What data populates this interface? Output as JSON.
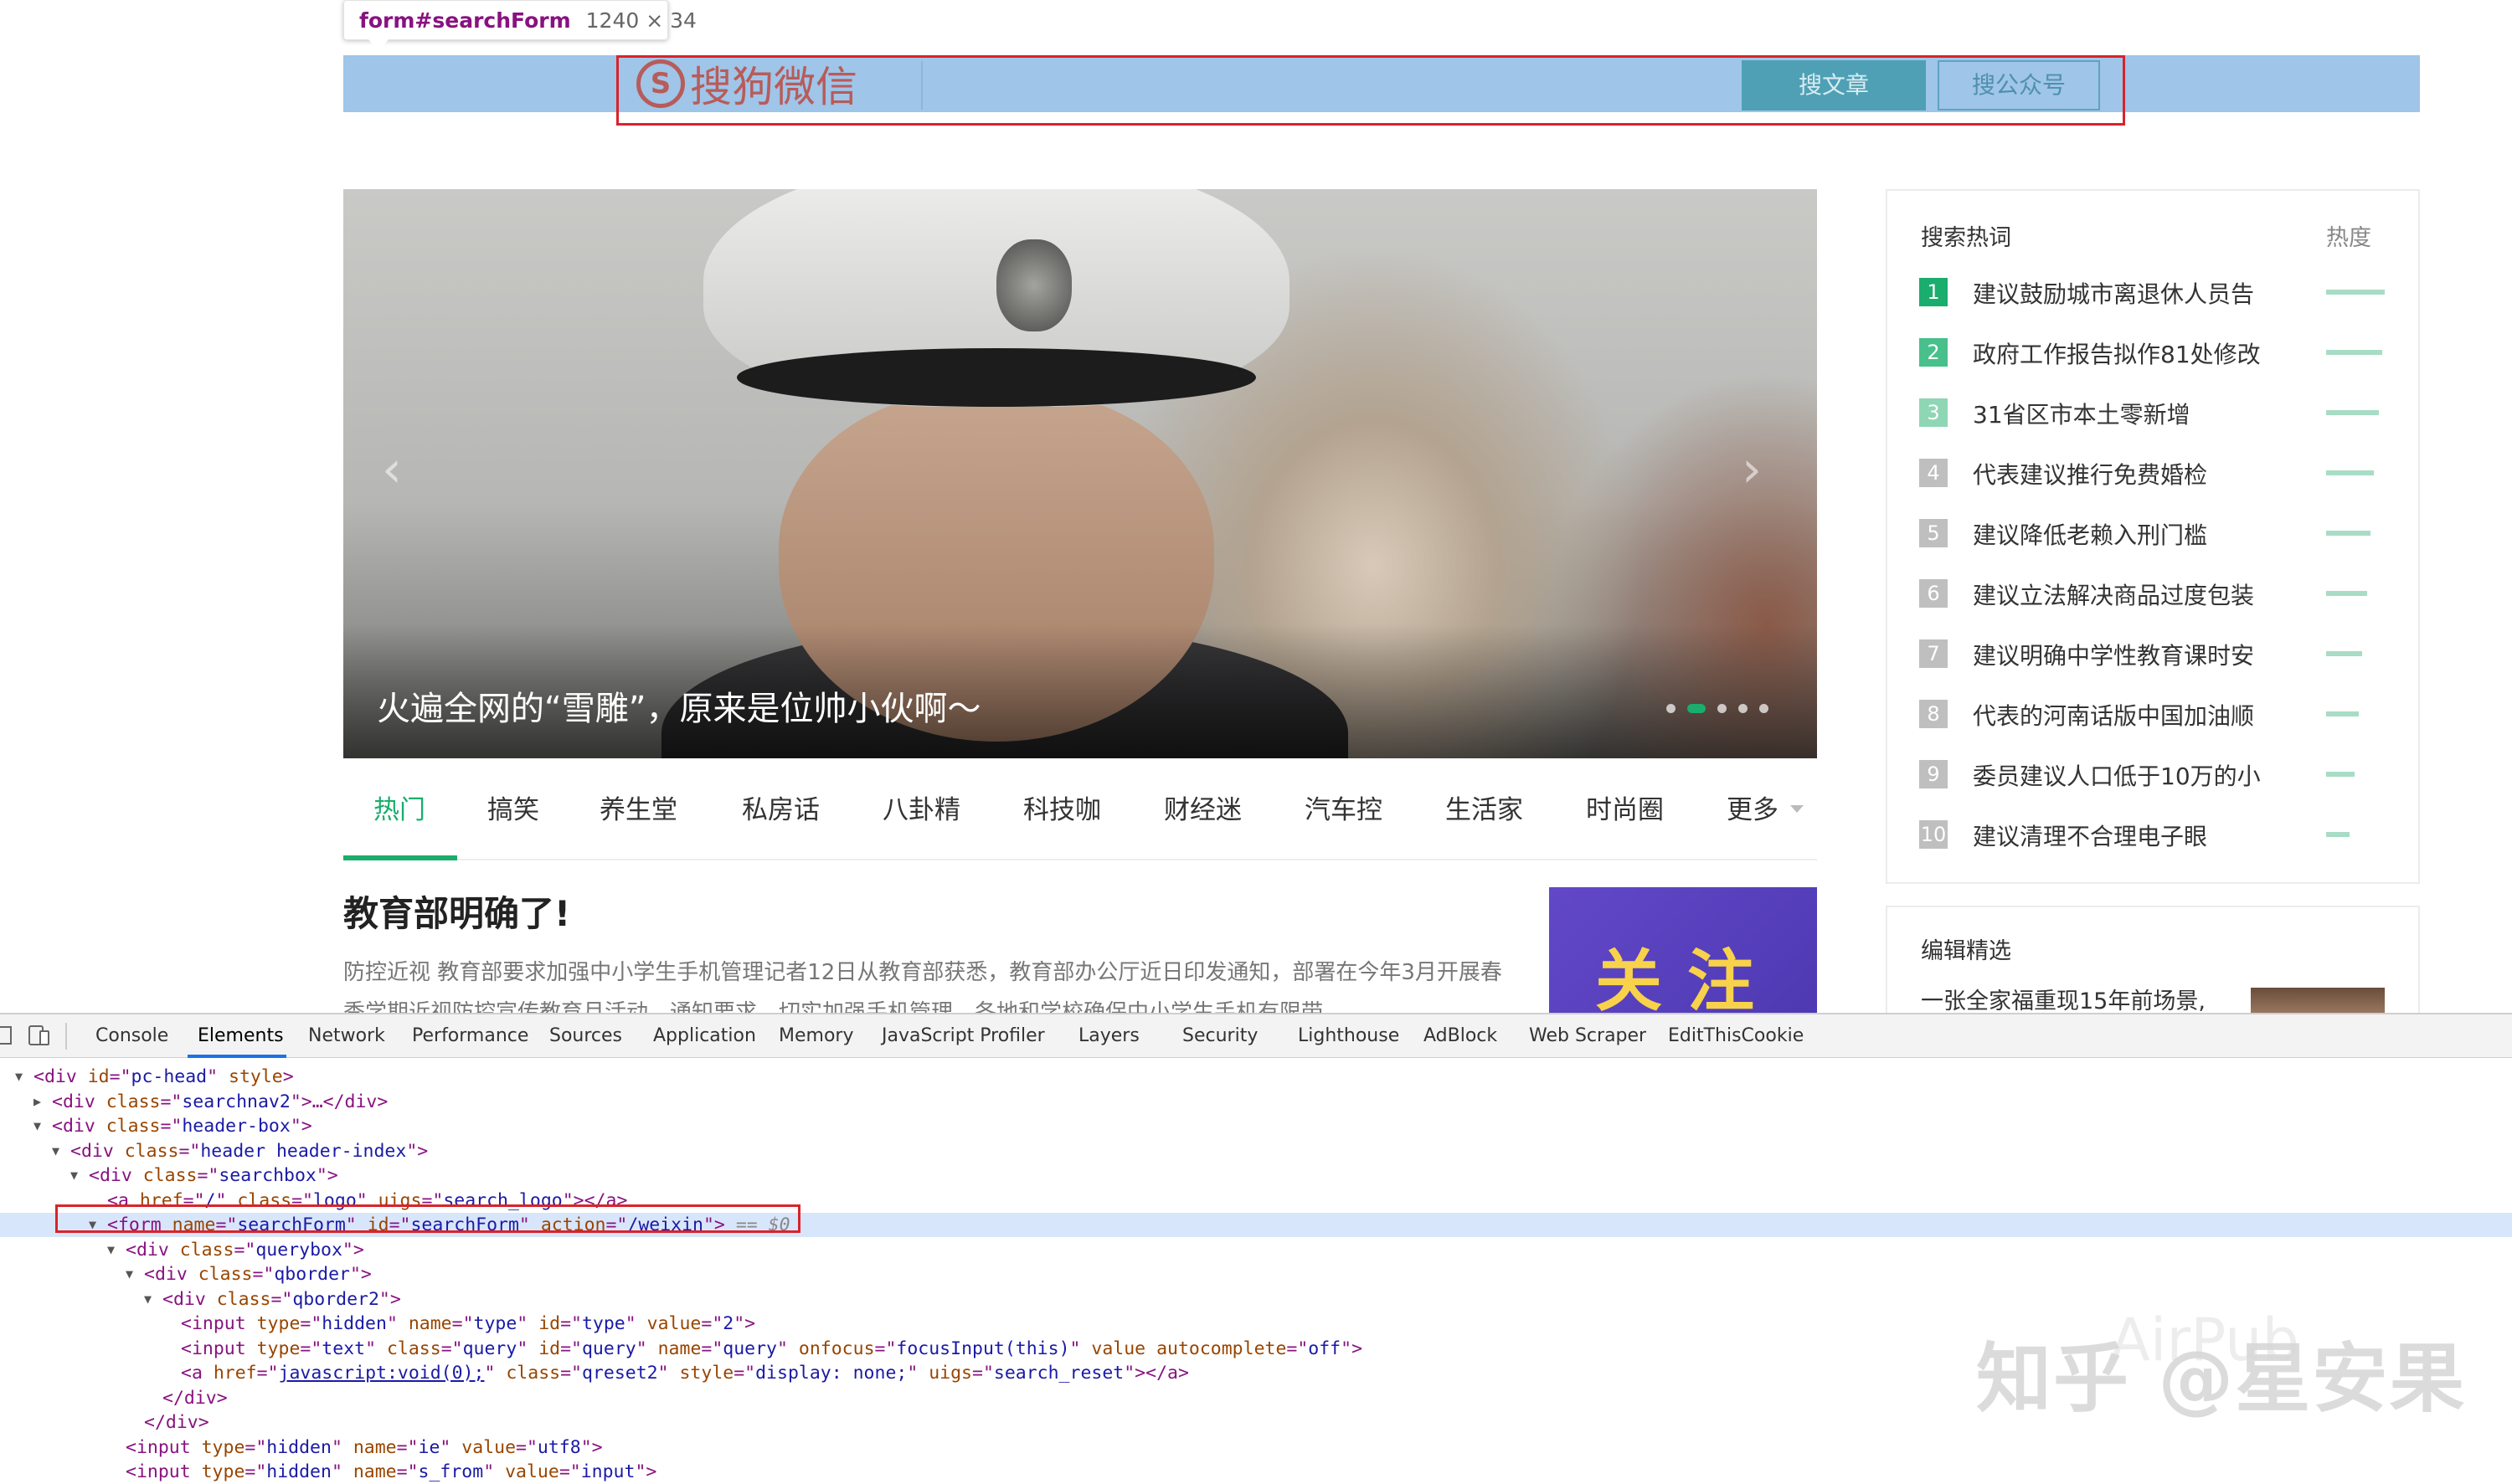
{
  "tooltip": {
    "tag": "form#searchForm",
    "size": "1240 × 34"
  },
  "header": {
    "logo_text": "搜狗微信",
    "logo_mark": "S",
    "btn_article": "搜文章",
    "btn_account": "搜公众号"
  },
  "carousel": {
    "caption": "火遍全网的“雪雕”，原来是位帅小伙啊～",
    "prev_glyph": "‹",
    "next_glyph": "›",
    "slide_count": 5,
    "active_slide": 2
  },
  "tabs": [
    "热门",
    "搞笑",
    "养生堂",
    "私房话",
    "八卦精",
    "科技咖",
    "财经迷",
    "汽车控",
    "生活家",
    "时尚圈",
    "更多"
  ],
  "active_tab": 0,
  "article": {
    "title": "教育部明确了!",
    "summary": "防控近视 教育部要求加强中小学生手机管理记者12日从教育部获悉，教育部办公厅近日印发通知，部署在今年3月开展春季学期近视防控宣传教育月活动。通知要求，切实加强手机管理。各地和学校确保中小学生手机有限带",
    "ad_text": "关注"
  },
  "hot": {
    "title": "搜索热词",
    "heat_label": "热度",
    "items": [
      {
        "rank": "1",
        "text": "建议鼓励城市离退休人员告",
        "heat": 1.0,
        "color": "#1aad6d"
      },
      {
        "rank": "2",
        "text": "政府工作报告拟作81处修改",
        "heat": 0.95,
        "color": "#48c08b"
      },
      {
        "rank": "3",
        "text": "31省区市本土零新增",
        "heat": 0.9,
        "color": "#8fd6b4"
      },
      {
        "rank": "4",
        "text": "代表建议推行免费婚检",
        "heat": 0.82,
        "color": "#bfbfbf"
      },
      {
        "rank": "5",
        "text": "建议降低老赖入刑门槛",
        "heat": 0.76,
        "color": "#bfbfbf"
      },
      {
        "rank": "6",
        "text": "建议立法解决商品过度包装",
        "heat": 0.7,
        "color": "#bfbfbf"
      },
      {
        "rank": "7",
        "text": "建议明确中学性教育课时安",
        "heat": 0.62,
        "color": "#bfbfbf"
      },
      {
        "rank": "8",
        "text": "代表的河南话版中国加油顺",
        "heat": 0.55,
        "color": "#bfbfbf"
      },
      {
        "rank": "9",
        "text": "委员建议人口低于10万的小",
        "heat": 0.48,
        "color": "#bfbfbf"
      },
      {
        "rank": "10",
        "text": "建议清理不合理电子眼",
        "heat": 0.4,
        "color": "#bfbfbf"
      }
    ]
  },
  "editor": {
    "title": "编辑精选",
    "item": "一张全家福重现15年前场景,"
  },
  "devtools": {
    "tabs": [
      "Console",
      "Elements",
      "Network",
      "Performance",
      "Sources",
      "Application",
      "Memory",
      "JavaScript Profiler",
      "Layers",
      "Security",
      "Lighthouse",
      "AdBlock",
      "Web Scraper",
      "EditThisCookie"
    ],
    "active_tab": 1
  },
  "dom": [
    {
      "twisty": "open",
      "parts": [
        [
          "t",
          "<div "
        ],
        [
          "a",
          "id"
        ],
        [
          "t",
          "=\""
        ],
        [
          "v",
          "pc-head"
        ],
        [
          "t",
          "\" "
        ],
        [
          "a",
          "style"
        ],
        [
          "t",
          ">"
        ]
      ]
    },
    {
      "twisty": "closed",
      "parts": [
        [
          "t",
          "<div "
        ],
        [
          "a",
          "class"
        ],
        [
          "t",
          "=\""
        ],
        [
          "v",
          "searchnav2"
        ],
        [
          "t",
          "\">…</div>"
        ]
      ]
    },
    {
      "twisty": "open",
      "parts": [
        [
          "t",
          "<div "
        ],
        [
          "a",
          "class"
        ],
        [
          "t",
          "=\""
        ],
        [
          "v",
          "header-box"
        ],
        [
          "t",
          "\">"
        ]
      ]
    },
    {
      "twisty": "open",
      "parts": [
        [
          "t",
          "<div "
        ],
        [
          "a",
          "class"
        ],
        [
          "t",
          "=\""
        ],
        [
          "v",
          "header header-index"
        ],
        [
          "t",
          "\">"
        ]
      ]
    },
    {
      "twisty": "open",
      "parts": [
        [
          "t",
          "<div "
        ],
        [
          "a",
          "class"
        ],
        [
          "t",
          "=\""
        ],
        [
          "v",
          "searchbox"
        ],
        [
          "t",
          "\">"
        ]
      ]
    },
    {
      "twisty": "none",
      "parts": [
        [
          "t",
          "<a "
        ],
        [
          "a",
          "href"
        ],
        [
          "t",
          "=\""
        ],
        [
          "v",
          "/"
        ],
        [
          "t",
          "\" "
        ],
        [
          "a",
          "class"
        ],
        [
          "t",
          "=\""
        ],
        [
          "v",
          "logo"
        ],
        [
          "t",
          "\" "
        ],
        [
          "a",
          "uigs"
        ],
        [
          "t",
          "=\""
        ],
        [
          "v",
          "search_logo"
        ],
        [
          "t",
          "\"></a>"
        ]
      ]
    },
    {
      "twisty": "open",
      "selected": true,
      "parts": [
        [
          "t",
          "<form "
        ],
        [
          "a",
          "name"
        ],
        [
          "t",
          "=\""
        ],
        [
          "v",
          "searchForm"
        ],
        [
          "t",
          "\" "
        ],
        [
          "a",
          "id"
        ],
        [
          "t",
          "=\""
        ],
        [
          "v",
          "searchForm"
        ],
        [
          "t",
          "\" "
        ],
        [
          "a",
          "action"
        ],
        [
          "t",
          "=\""
        ],
        [
          "v",
          "/weixin"
        ],
        [
          "t",
          "\">"
        ],
        [
          "e",
          " == $0"
        ]
      ]
    },
    {
      "twisty": "open",
      "parts": [
        [
          "t",
          "<div "
        ],
        [
          "a",
          "class"
        ],
        [
          "t",
          "=\""
        ],
        [
          "v",
          "querybox"
        ],
        [
          "t",
          "\">"
        ]
      ]
    },
    {
      "twisty": "open",
      "parts": [
        [
          "t",
          "<div "
        ],
        [
          "a",
          "class"
        ],
        [
          "t",
          "=\""
        ],
        [
          "v",
          "qborder"
        ],
        [
          "t",
          "\">"
        ]
      ]
    },
    {
      "twisty": "open",
      "parts": [
        [
          "t",
          "<div "
        ],
        [
          "a",
          "class"
        ],
        [
          "t",
          "=\""
        ],
        [
          "v",
          "qborder2"
        ],
        [
          "t",
          "\">"
        ]
      ]
    },
    {
      "twisty": "none",
      "parts": [
        [
          "t",
          "<input "
        ],
        [
          "a",
          "type"
        ],
        [
          "t",
          "=\""
        ],
        [
          "v",
          "hidden"
        ],
        [
          "t",
          "\" "
        ],
        [
          "a",
          "name"
        ],
        [
          "t",
          "=\""
        ],
        [
          "v",
          "type"
        ],
        [
          "t",
          "\" "
        ],
        [
          "a",
          "id"
        ],
        [
          "t",
          "=\""
        ],
        [
          "v",
          "type"
        ],
        [
          "t",
          "\" "
        ],
        [
          "a",
          "value"
        ],
        [
          "t",
          "=\""
        ],
        [
          "v",
          "2"
        ],
        [
          "t",
          "\">"
        ]
      ]
    },
    {
      "twisty": "none",
      "parts": [
        [
          "t",
          "<input "
        ],
        [
          "a",
          "type"
        ],
        [
          "t",
          "=\""
        ],
        [
          "v",
          "text"
        ],
        [
          "t",
          "\" "
        ],
        [
          "a",
          "class"
        ],
        [
          "t",
          "=\""
        ],
        [
          "v",
          "query"
        ],
        [
          "t",
          "\" "
        ],
        [
          "a",
          "id"
        ],
        [
          "t",
          "=\""
        ],
        [
          "v",
          "query"
        ],
        [
          "t",
          "\" "
        ],
        [
          "a",
          "name"
        ],
        [
          "t",
          "=\""
        ],
        [
          "v",
          "query"
        ],
        [
          "t",
          "\" "
        ],
        [
          "a",
          "onfocus"
        ],
        [
          "t",
          "=\""
        ],
        [
          "v",
          "focusInput(this)"
        ],
        [
          "t",
          "\" "
        ],
        [
          "a",
          "value autocomplete"
        ],
        [
          "t",
          "=\""
        ],
        [
          "v",
          "off"
        ],
        [
          "t",
          "\">"
        ]
      ]
    },
    {
      "twisty": "none",
      "parts": [
        [
          "t",
          "<a "
        ],
        [
          "a",
          "href"
        ],
        [
          "t",
          "=\""
        ],
        [
          "l",
          "javascript:void(0);"
        ],
        [
          "t",
          "\" "
        ],
        [
          "a",
          "class"
        ],
        [
          "t",
          "=\""
        ],
        [
          "v",
          "qreset2"
        ],
        [
          "t",
          "\" "
        ],
        [
          "a",
          "style"
        ],
        [
          "t",
          "=\""
        ],
        [
          "v",
          "display: none;"
        ],
        [
          "t",
          "\" "
        ],
        [
          "a",
          "uigs"
        ],
        [
          "t",
          "=\""
        ],
        [
          "v",
          "search_reset"
        ],
        [
          "t",
          "\"></a>"
        ]
      ]
    },
    {
      "twisty": "none",
      "parts": [
        [
          "t",
          "</div>"
        ]
      ]
    },
    {
      "twisty": "none",
      "parts": [
        [
          "t",
          "</div>"
        ]
      ]
    },
    {
      "twisty": "none",
      "parts": [
        [
          "t",
          "<input "
        ],
        [
          "a",
          "type"
        ],
        [
          "t",
          "=\""
        ],
        [
          "v",
          "hidden"
        ],
        [
          "t",
          "\" "
        ],
        [
          "a",
          "name"
        ],
        [
          "t",
          "=\""
        ],
        [
          "v",
          "ie"
        ],
        [
          "t",
          "\" "
        ],
        [
          "a",
          "value"
        ],
        [
          "t",
          "=\""
        ],
        [
          "v",
          "utf8"
        ],
        [
          "t",
          "\">"
        ]
      ]
    },
    {
      "twisty": "none",
      "parts": [
        [
          "t",
          "<input "
        ],
        [
          "a",
          "type"
        ],
        [
          "t",
          "=\""
        ],
        [
          "v",
          "hidden"
        ],
        [
          "t",
          "\" "
        ],
        [
          "a",
          "name"
        ],
        [
          "t",
          "=\""
        ],
        [
          "v",
          "s_from"
        ],
        [
          "t",
          "\" "
        ],
        [
          "a",
          "value"
        ],
        [
          "t",
          "=\""
        ],
        [
          "v",
          "input"
        ],
        [
          "t",
          "\">"
        ]
      ]
    }
  ],
  "watermark": "知乎 @星安果",
  "watermark_fade": "AirPub"
}
